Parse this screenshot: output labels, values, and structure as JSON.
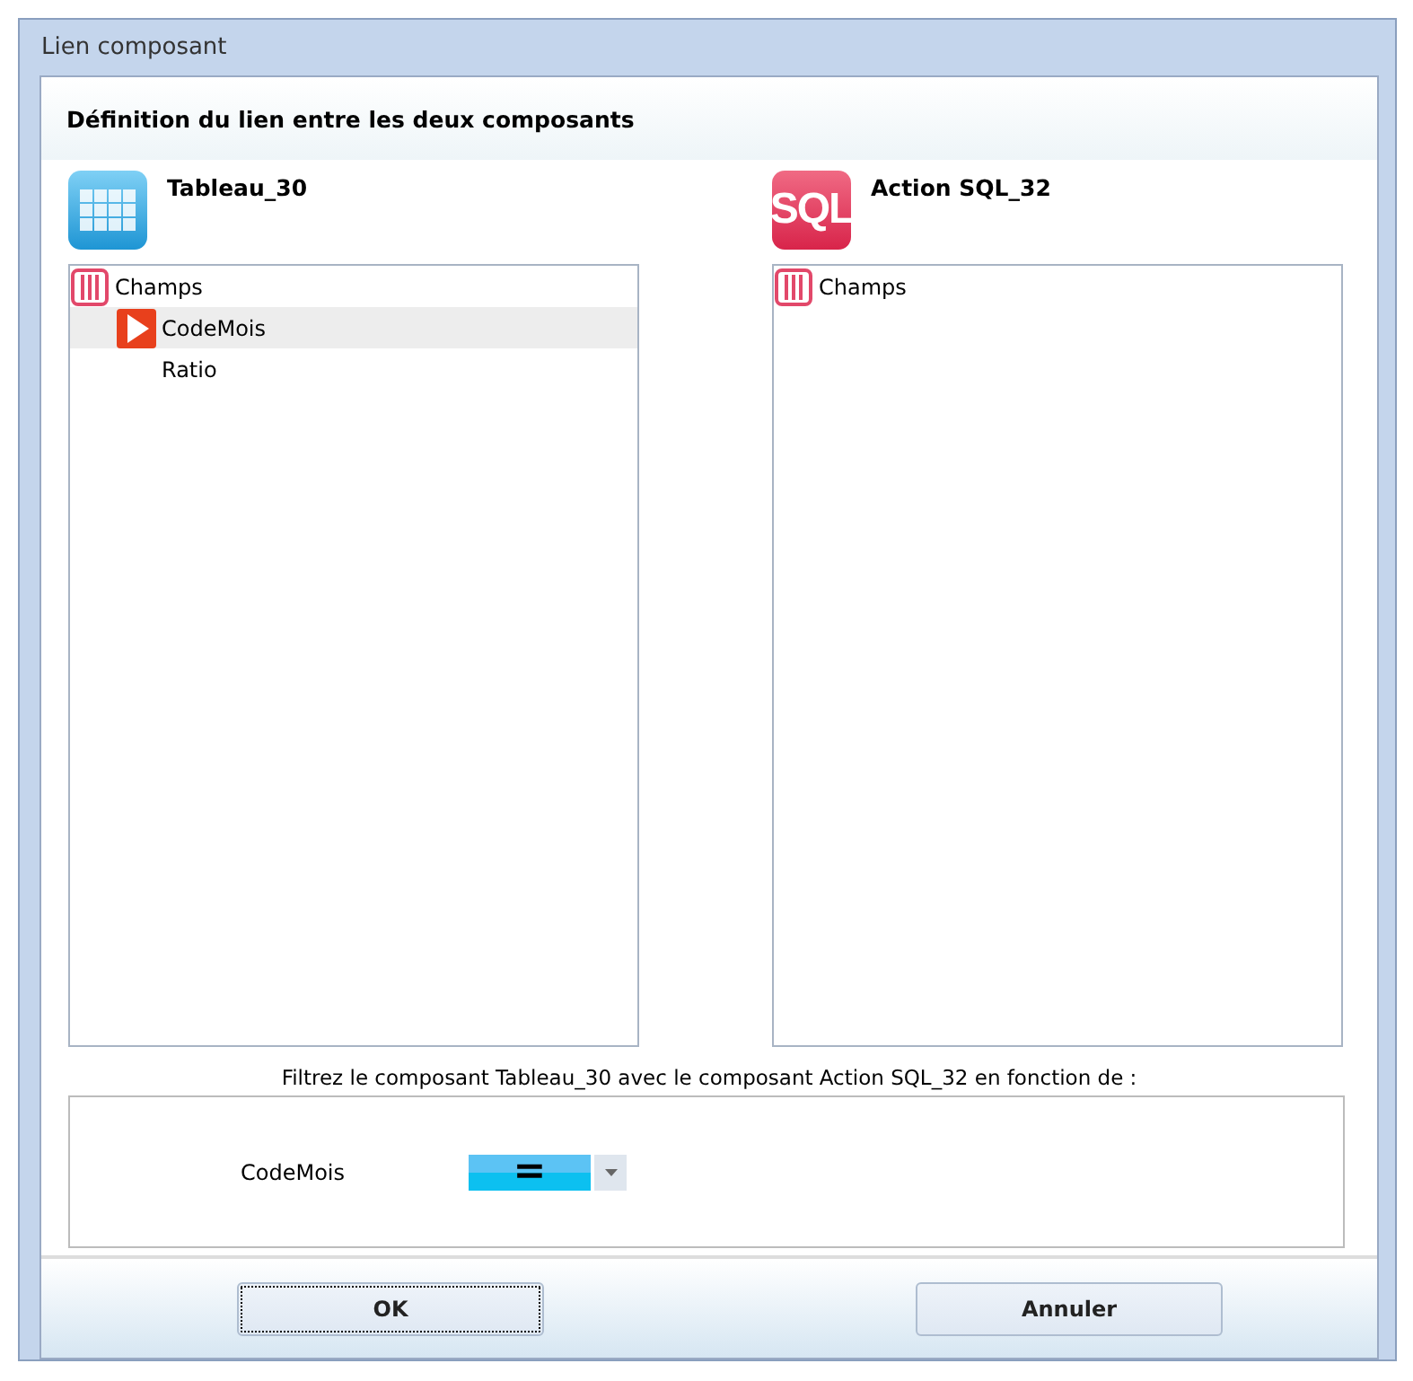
{
  "window": {
    "title": "Lien composant"
  },
  "header": "Définition du lien entre les deux composants",
  "components": [
    {
      "kind": "table",
      "name": "Tableau_30",
      "tree": [
        {
          "label": "Champs",
          "selected": false,
          "children": [
            {
              "label": "CodeMois",
              "selected": true
            },
            {
              "label": "Ratio",
              "selected": false
            }
          ]
        }
      ]
    },
    {
      "kind": "sql",
      "icon_label": "SQL",
      "name": "Action SQL_32",
      "tree": [
        {
          "label": "Champs",
          "selected": false
        }
      ]
    }
  ],
  "filter_caption": "Filtrez le composant Tableau_30 avec le composant Action SQL_32 en fonction de :",
  "filter_rows": [
    {
      "label": "CodeMois",
      "operator": "="
    }
  ],
  "buttons": [
    {
      "label": "OK",
      "focused": true
    },
    {
      "label": "Annuler",
      "focused": false
    }
  ]
}
